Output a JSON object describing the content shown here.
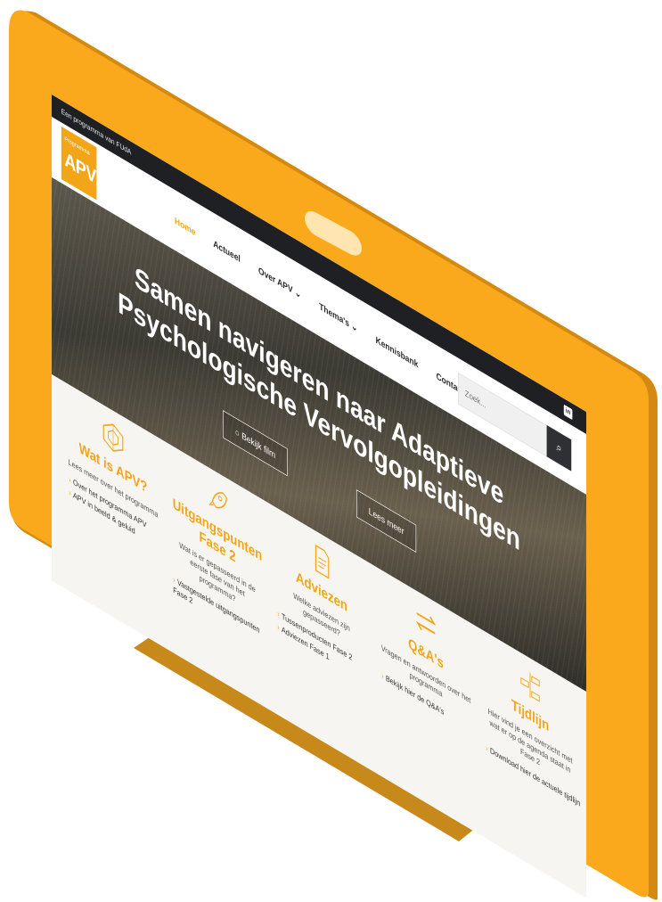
{
  "colors": {
    "frame_orange": "#f9a91b",
    "frame_shadow": "#d48a10",
    "accent": "#f2a516",
    "dark_bar": "#1f2023",
    "search_button": "#2e3034"
  },
  "topbar": {
    "program_label": "Een programma van FUdA",
    "linkedin_icon": "linkedin-icon"
  },
  "header": {
    "logo_small": "Programma",
    "logo_big": "APV",
    "nav": {
      "home": "Home",
      "actueel": "Actueel",
      "over_apv": "Over APV ⌄",
      "themas": "Thema's ⌄",
      "kennisbank": "Kennisbank",
      "contact": "Contact"
    },
    "search": {
      "placeholder": "Zoek...",
      "button_icon": "search-icon"
    }
  },
  "hero": {
    "title": "Samen navigeren naar Adaptieve Psychologische Vervolgopleidingen",
    "film_button": "Bekijk film",
    "more_button": "Lees meer"
  },
  "cards": [
    {
      "icon": "hexagon-network-icon",
      "title": "Wat is APV?",
      "desc": "Lees meer over het programma",
      "links": [
        "Over het programma APV",
        "APV in beeld & geluid"
      ]
    },
    {
      "icon": "rocket-icon",
      "title": "Uitgangspunten Fase 2",
      "desc": "Wat is er gepasseerd in de eerste fase van het programma?",
      "links": [
        "Vastgestelde uitgangspunten Fase 2"
      ]
    },
    {
      "icon": "document-icon",
      "title": "Adviezen",
      "desc": "Welke adviezen zijn gepasseerd?",
      "links": [
        "Tussenproducten Fase 2",
        "Adviezen Fase 1"
      ]
    },
    {
      "icon": "arrows-exchange-icon",
      "title": "Q&A's",
      "desc": "Vragen en antwoorden over het programma",
      "links": [
        "Bekijk hier de Q&A's"
      ]
    },
    {
      "icon": "timeline-icon",
      "title": "Tijdlijn",
      "desc": "Hier vind je een overzicht met wat er op de agenda staat in Fase 2",
      "links": [
        "Download hier de actuele tijdlijn"
      ]
    }
  ]
}
